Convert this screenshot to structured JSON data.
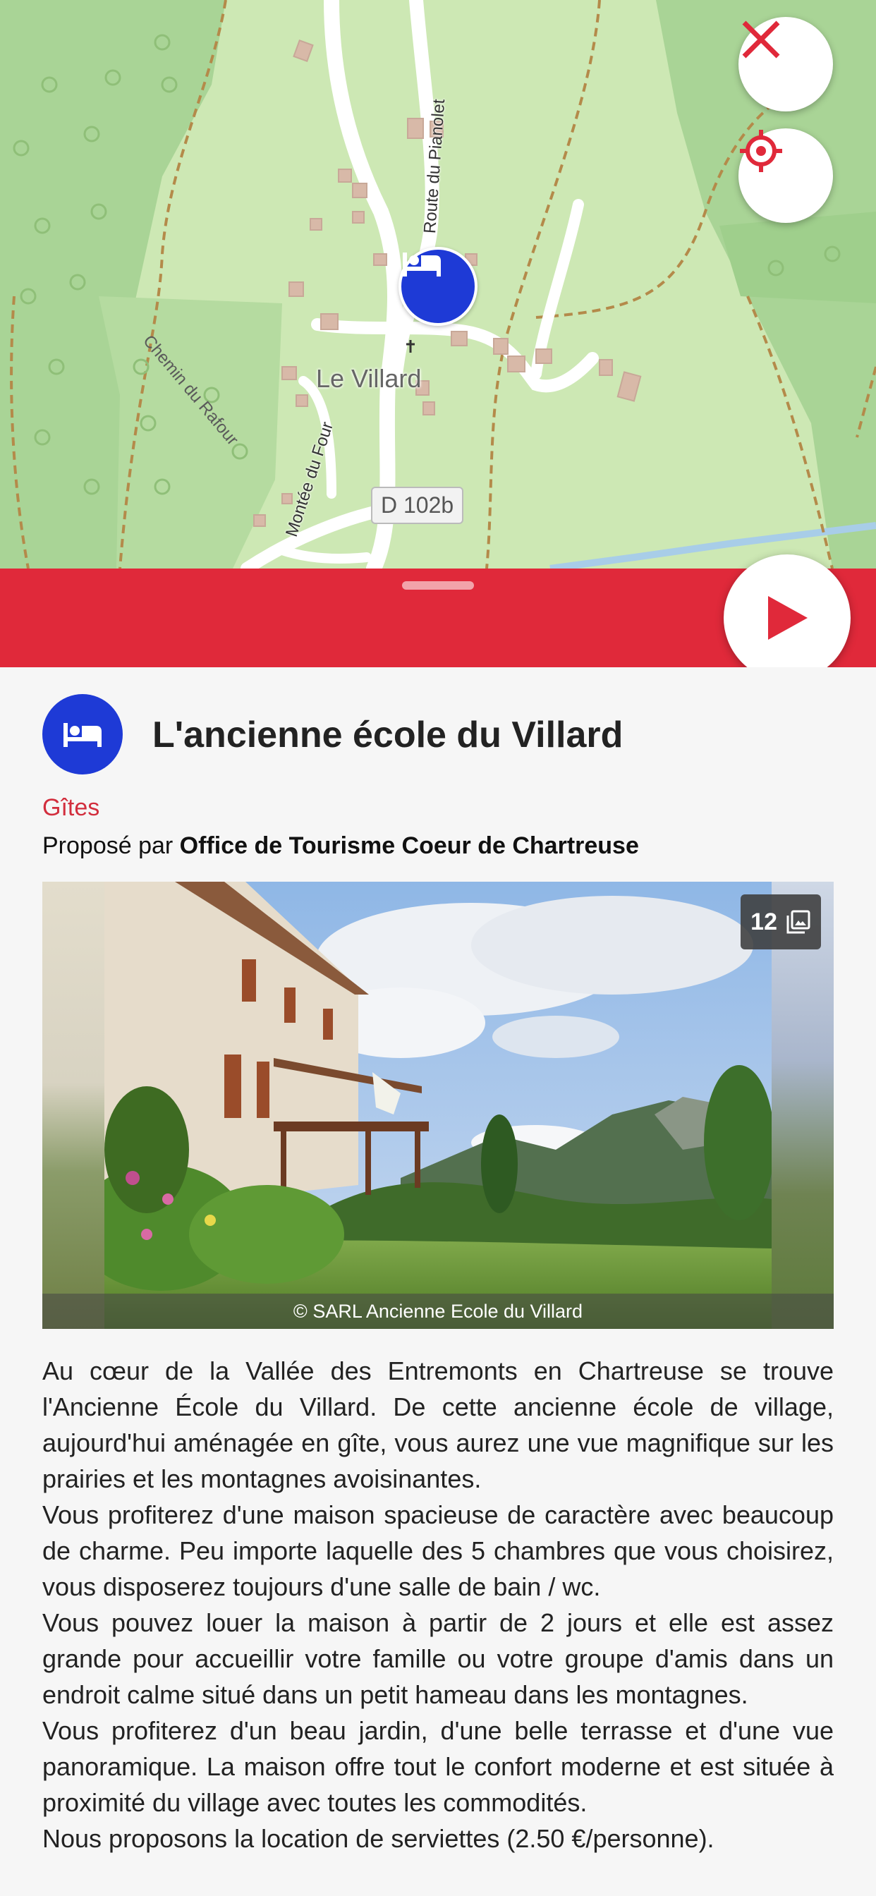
{
  "map": {
    "labels": {
      "village": "Le Villard",
      "road_rafour": "Chemin du Rafour",
      "road_pianolet": "Route du Pianolet",
      "road_four": "Montée du Four",
      "road_number": "D 102b"
    },
    "marker_icon": "bed-icon",
    "buttons": {
      "close_icon": "close-icon",
      "locate_icon": "crosshair-icon"
    }
  },
  "bar": {
    "color": "#e0293a",
    "play_icon": "play-icon"
  },
  "place": {
    "title": "L'ancienne école du Villard",
    "category": "Gîtes",
    "offered_by_prefix": "Proposé par ",
    "offered_by": "Office de Tourisme Coeur de Chartreuse",
    "category_icon": "bed-icon"
  },
  "photo": {
    "count": "12",
    "caption": "© SARL Ancienne Ecole du Villard"
  },
  "description": [
    "Au cœur de la Vallée des Entremonts en Chartreuse se trouve l'Ancienne École du Villard. De cette ancienne école de village, aujourd'hui aménagée en gîte, vous aurez une vue magnifique sur les prairies et les montagnes avoisinantes.",
    "Vous profiterez d'une maison spacieuse de caractère avec beaucoup de charme. Peu importe laquelle des 5 chambres que vous choisirez, vous disposerez toujours d'une salle de bain / wc.",
    "Vous pouvez louer la maison à partir de 2 jours et elle est assez grande pour accueillir votre famille ou votre groupe d'amis dans un endroit calme situé dans un petit hameau dans les montagnes.",
    "Vous profiterez d'un beau jardin, d'une belle terrasse et d'une vue panoramique. La maison offre tout le confort moderne et est située à proximité du village avec toutes les commodités.",
    "Nous proposons la location de serviettes (2.50 €/personne)."
  ],
  "colors": {
    "accent_red": "#e0293a",
    "marker_blue": "#1e3ad6",
    "category_red": "#d22e3d"
  }
}
